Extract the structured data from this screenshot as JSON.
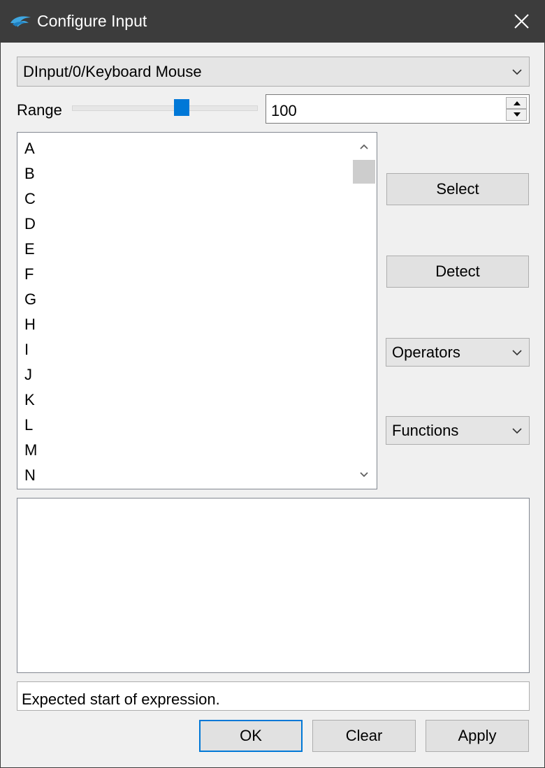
{
  "window": {
    "title": "Configure Input",
    "icon": "dolphin-logo-icon",
    "titlebar_color": "#3c3c3c"
  },
  "device_select": {
    "value": "DInput/0/Keyboard Mouse"
  },
  "range": {
    "label": "Range",
    "slider_fraction": 0.59,
    "value": "100"
  },
  "key_list": {
    "items": [
      "A",
      "B",
      "C",
      "D",
      "E",
      "F",
      "G",
      "H",
      "I",
      "J",
      "K",
      "L",
      "M",
      "N"
    ]
  },
  "buttons": {
    "select": "Select",
    "detect": "Detect",
    "ok": "OK",
    "clear": "Clear",
    "apply": "Apply"
  },
  "dropdowns": {
    "operators": "Operators",
    "functions": "Functions"
  },
  "expression": {
    "value": ""
  },
  "status": {
    "message": "Expected start of expression."
  },
  "colors": {
    "accent": "#0078d7"
  }
}
